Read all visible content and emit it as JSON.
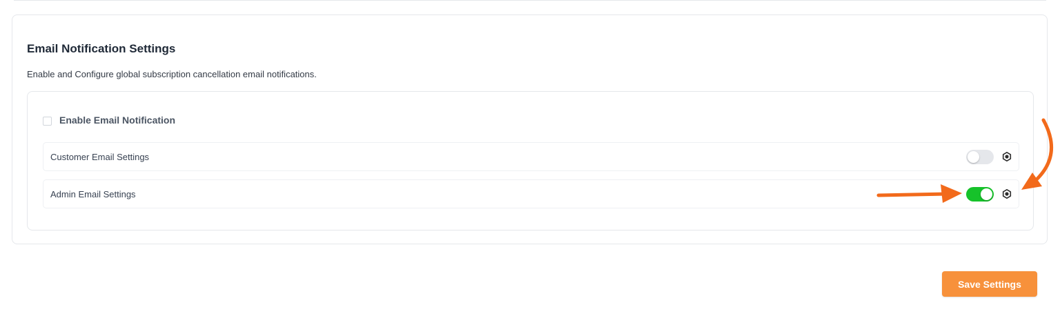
{
  "section": {
    "title": "Email Notification Settings",
    "description": "Enable and Configure global subscription cancellation email notifications."
  },
  "enable_notification": {
    "label": "Enable Email Notification",
    "checked": false
  },
  "settings_rows": [
    {
      "label": "Customer Email Settings",
      "enabled": false,
      "icon": "gear-icon"
    },
    {
      "label": "Admin Email Settings",
      "enabled": true,
      "icon": "gear-icon"
    }
  ],
  "actions": {
    "save_label": "Save Settings"
  },
  "colors": {
    "toggle_on": "#16c22a",
    "toggle_off": "#e5e7eb",
    "save_button": "#f7913b",
    "annotation_arrow": "#f26a1b"
  }
}
